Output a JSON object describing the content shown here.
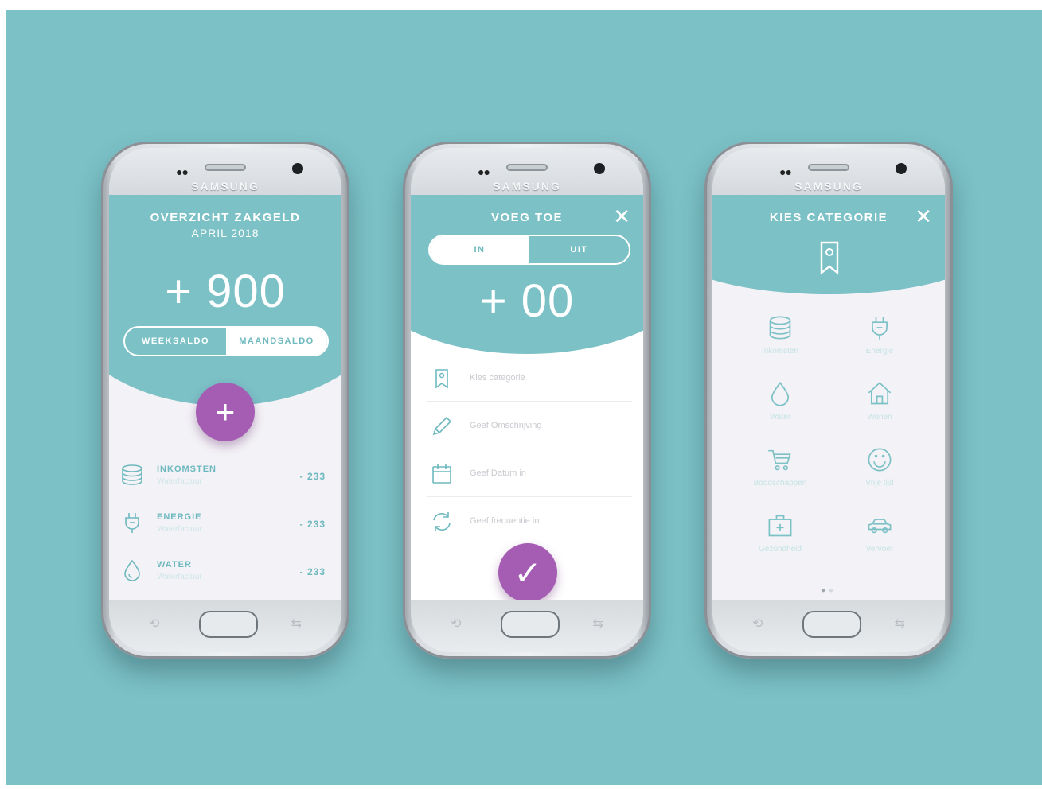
{
  "phones": [
    {
      "brand": "SAMSUNG",
      "screen1": {
        "title": "OVERZICHT ZAKGELD",
        "subtitle": "APRIL 2018",
        "balance": "+ 900",
        "toggle": {
          "left": "WEEKSALDO",
          "right": "MAANDSALDO"
        },
        "fab_symbol": "+",
        "items": [
          {
            "name": "INKOMSTEN",
            "desc": "Waterfactuur",
            "amount": "- 233",
            "icon": "database-icon"
          },
          {
            "name": "ENERGIE",
            "desc": "Waterfactuur",
            "amount": "- 233",
            "icon": "plug-icon"
          },
          {
            "name": "WATER",
            "desc": "Waterfactuur",
            "amount": "- 233",
            "icon": "drop-icon"
          }
        ]
      }
    },
    {
      "brand": "SAMSUNG",
      "screen2": {
        "title": "VOEG TOE",
        "close_symbol": "✕",
        "toggle": {
          "left": "IN",
          "right": "UIT"
        },
        "amount": "+ 00",
        "fields": [
          {
            "label": "Kies categorie",
            "icon": "tag-icon"
          },
          {
            "label": "Geef Omschrijving",
            "icon": "pencil-icon"
          },
          {
            "label": "Geef Datum in",
            "icon": "calendar-icon"
          },
          {
            "label": "Geef frequentie in",
            "icon": "refresh-icon"
          }
        ],
        "confirm_symbol": "✓"
      }
    },
    {
      "brand": "SAMSUNG",
      "screen3": {
        "title": "KIES CATEGORIE",
        "close_symbol": "✕",
        "categories": [
          {
            "label": "Inkomsten",
            "icon": "database-icon"
          },
          {
            "label": "Energie",
            "icon": "plug-icon"
          },
          {
            "label": "Water",
            "icon": "drop-icon"
          },
          {
            "label": "Wonen",
            "icon": "house-icon"
          },
          {
            "label": "Boodschappen",
            "icon": "cart-icon"
          },
          {
            "label": "Vrije tijd",
            "icon": "smiley-icon"
          },
          {
            "label": "Gezondheid",
            "icon": "first-aid-icon"
          },
          {
            "label": "Vervoer",
            "icon": "car-icon"
          }
        ],
        "pager": "● ●"
      }
    }
  ],
  "colors": {
    "background": "#7bc1c6",
    "accent": "#a55db4",
    "teal": "#6db9bf"
  }
}
